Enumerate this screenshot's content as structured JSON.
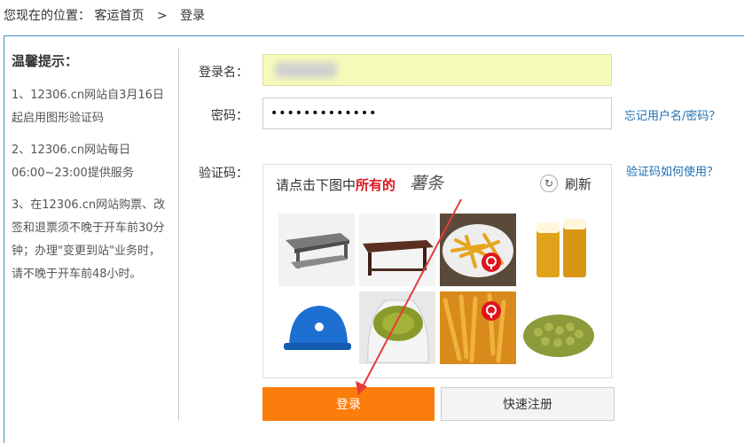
{
  "breadcrumb": {
    "prefix": "您现在的位置：",
    "home": "客运首页",
    "separator": ">",
    "current": "登录"
  },
  "tips": {
    "title": "温馨提示：",
    "items": [
      "1、12306.cn网站自3月16日起启用图形验证码",
      "2、12306.cn网站每日06:00~23:00提供服务",
      "3、在12306.cn网站购票、改签和退票须不晚于开车前30分钟；办理\"变更到站\"业务时，请不晚于开车前48小时。"
    ]
  },
  "form": {
    "username_label": "登录名：",
    "password_label": "密码：",
    "password_value": "•••••••••••••",
    "forgot_link": "忘记用户名/密码？",
    "captcha_label": "验证码：",
    "captcha_help_link": "验证码如何使用？"
  },
  "captcha": {
    "prompt_prefix": "请点击下图中",
    "prompt_emphasis": "所有的",
    "target_word": "薯条",
    "refresh_label": "刷新",
    "tiles": [
      {
        "name": "coffee-table",
        "selected": false
      },
      {
        "name": "wooden-table",
        "selected": false
      },
      {
        "name": "french-fries",
        "selected": true
      },
      {
        "name": "beer-glasses",
        "selected": false
      },
      {
        "name": "blue-hard-hat",
        "selected": false
      },
      {
        "name": "green-beans-sack",
        "selected": false
      },
      {
        "name": "fries-pile",
        "selected": true
      },
      {
        "name": "green-peas",
        "selected": false
      }
    ]
  },
  "buttons": {
    "login": "登录",
    "register": "快速注册"
  },
  "colors": {
    "accent_orange": "#fb7d0b",
    "link_blue": "#1b6fb5",
    "selected_marker": "#e0141e",
    "username_bg": "#f7fbb9"
  }
}
